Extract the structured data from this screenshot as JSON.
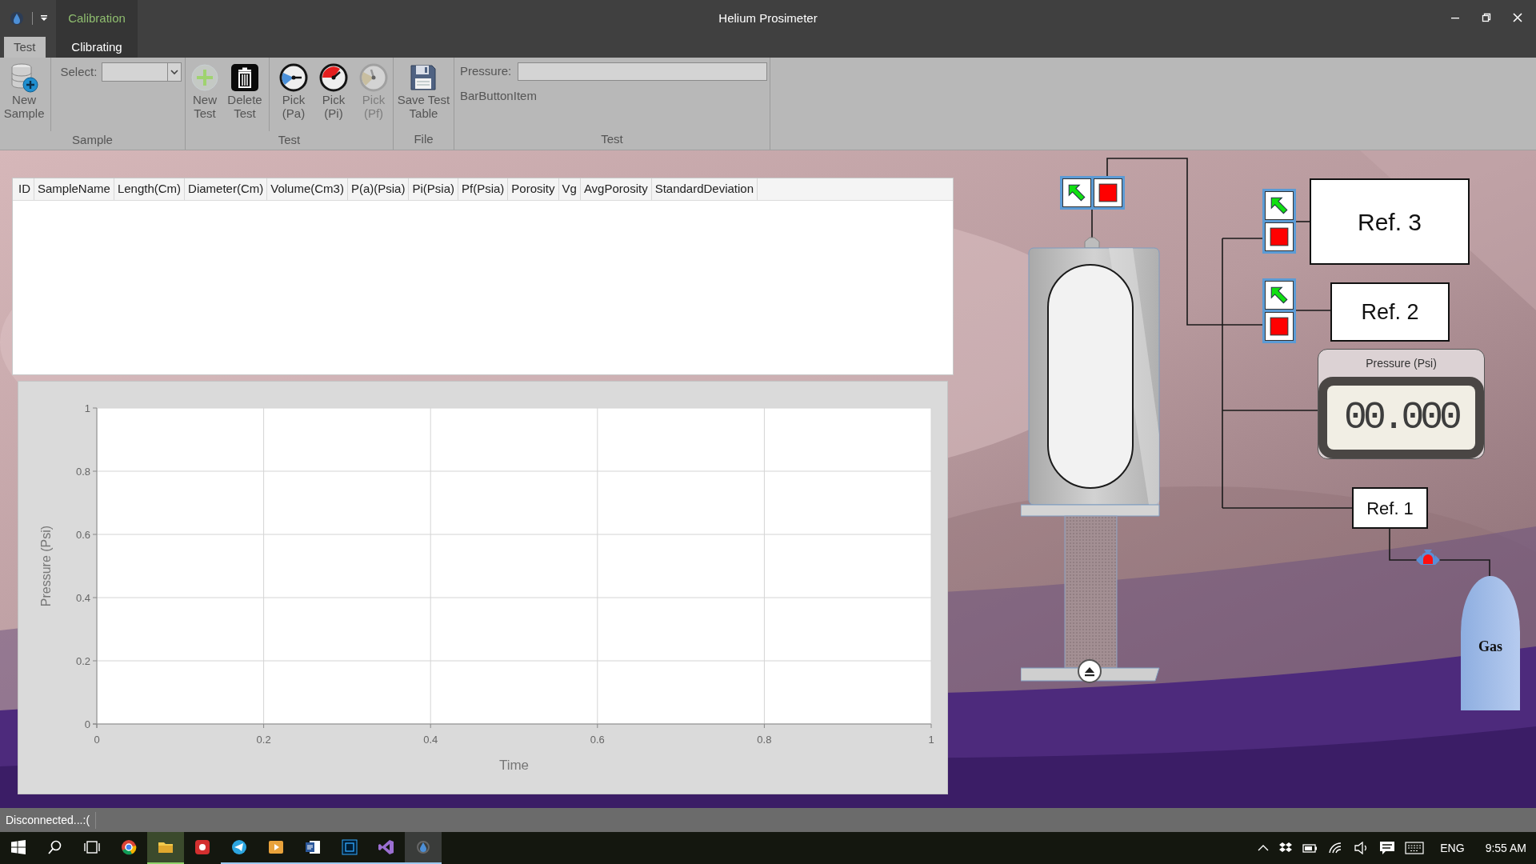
{
  "window": {
    "title": "Helium Prosimeter"
  },
  "context_tab_group": {
    "label": "Calibration"
  },
  "ribbon": {
    "tabs": [
      {
        "label": "Test",
        "selected": true
      },
      {
        "label": "Clibrating",
        "selected": false
      }
    ],
    "groups": [
      {
        "caption": "Sample",
        "items": [
          {
            "kind": "large_button",
            "label": "New\nSample",
            "disabled": false
          },
          {
            "kind": "combo",
            "label": "Select:"
          }
        ]
      },
      {
        "caption": "Test",
        "items": [
          {
            "kind": "large_button",
            "label": "New\nTest",
            "disabled": false
          },
          {
            "kind": "large_button",
            "label": "Delete\nTest",
            "disabled": false
          },
          {
            "kind": "gauge_button",
            "label": "Pick\n(Pa)",
            "disabled": false
          },
          {
            "kind": "gauge_button",
            "label": "Pick\n(Pi)",
            "disabled": false
          },
          {
            "kind": "gauge_button",
            "label": "Pick\n(Pf)",
            "disabled": true
          }
        ]
      },
      {
        "caption": "File",
        "items": [
          {
            "kind": "large_button",
            "label": "Save Test\nTable",
            "disabled": false
          }
        ]
      },
      {
        "caption": "Test",
        "items": [
          {
            "kind": "field",
            "label": "Pressure:"
          },
          {
            "kind": "text_button",
            "label": "BarButtonItem"
          }
        ]
      }
    ]
  },
  "table": {
    "columns": [
      "ID",
      "SampleName",
      "Length(Cm)",
      "Diameter(Cm)",
      "Volume(Cm3)",
      "P(a)(Psia)",
      "Pi(Psia)",
      "Pf(Psia)",
      "Porosity",
      "Vg",
      "AvgPorosity",
      "StandardDeviation"
    ]
  },
  "chart": {
    "chart_data": {
      "type": "line",
      "xlabel": "Time",
      "ylabel": "Pressure (Psi)",
      "xlim": [
        0,
        1
      ],
      "ylim": [
        0,
        1
      ],
      "xticks": [
        0,
        0.2,
        0.4,
        0.6,
        0.8,
        1
      ],
      "yticks": [
        0,
        0.2,
        0.4,
        0.6,
        0.8,
        1
      ],
      "grid": true
    }
  },
  "diagram": {
    "reference_chambers": [
      {
        "label": "Ref. 3"
      },
      {
        "label": "Ref. 2"
      },
      {
        "label": "Ref. 1"
      }
    ],
    "pressure_display": {
      "title": "Pressure (Psi)",
      "reading": "00.000"
    },
    "gas_tank": {
      "label": "Gas"
    }
  },
  "status_bar": {
    "text": "Disconnected...:("
  },
  "taskbar": {
    "language": "ENG",
    "time": "9:55 AM"
  }
}
